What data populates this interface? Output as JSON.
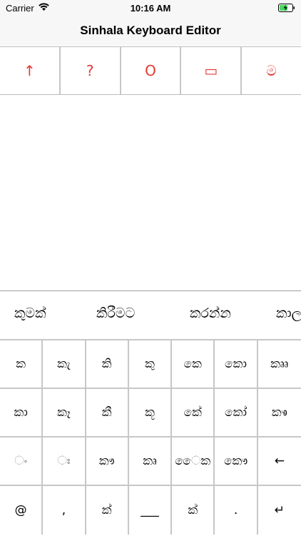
{
  "status_bar": {
    "carrier": "Carrier",
    "time": "10:16 AM"
  },
  "nav": {
    "title": "Sinhala Keyboard Editor"
  },
  "toolbar": {
    "buttons": [
      {
        "label": "↑",
        "icon": "up-arrow-icon"
      },
      {
        "label": "?",
        "icon": "question-icon"
      },
      {
        "label": "O",
        "icon": "circle-icon"
      },
      {
        "label": "▭",
        "icon": "rounded-rect-icon"
      },
      {
        "label": "ම",
        "icon": "sinhala-ma-icon"
      }
    ]
  },
  "keyboard": {
    "suggestions": [
      "කුමක්",
      "කිරීමට",
      "කරන්න",
      "කාල"
    ],
    "rows": [
      [
        "ක",
        "කැ",
        "කි",
        "කු",
        "කෙ",
        "කො",
        "කෲ"
      ],
      [
        "කා",
        "කෑ",
        "කී",
        "කූ",
        "කේ",
        "කෝ",
        "කෳ"
      ],
      [
        "ං",
        "ඃ",
        "කෟ",
        "කෘ",
        "ෛක",
        "කෞ",
        "←"
      ],
      [
        "@",
        ",",
        "ක්",
        "___",
        "ක්",
        ".",
        "↵"
      ]
    ]
  },
  "colors": {
    "accent": "#e53935",
    "bar_bg": "#f7f7f7",
    "grid": "#c7c7c7"
  }
}
